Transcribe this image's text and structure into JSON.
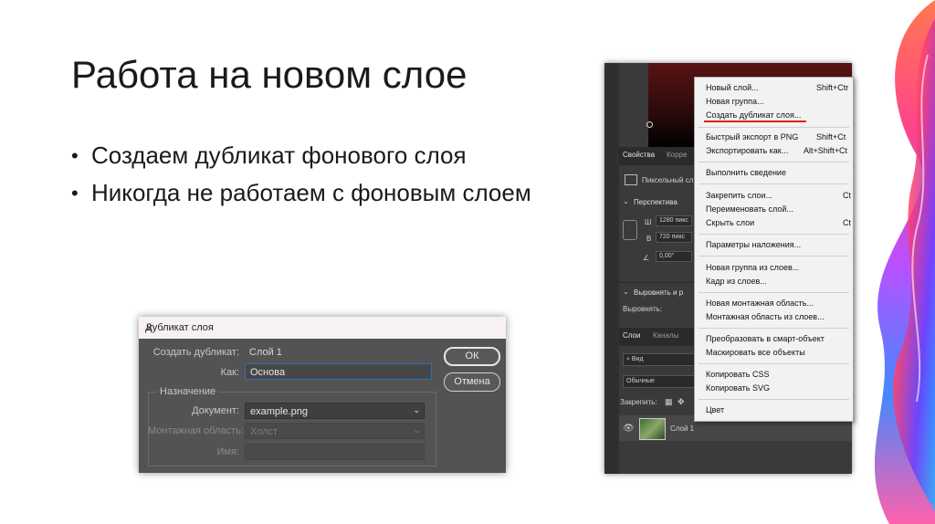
{
  "slide": {
    "title": "Работа на новом слое",
    "bullets": [
      "Создаем дубликат фонового слоя",
      "Никогда не работаем с фоновым слоем"
    ]
  },
  "dialog": {
    "title": "Дубликат слоя",
    "close": "✕",
    "duplicate_label": "Создать дубликат:",
    "duplicate_value": "Слой 1",
    "as_label": "Как:",
    "as_value": "Основа",
    "group_label": "Назначение",
    "document_label": "Документ:",
    "document_value": "example.png",
    "artboard_label": "Монтажная область:",
    "artboard_value": "Холст",
    "name_label": "Имя:",
    "name_value": "",
    "ok": "ОК",
    "cancel": "Отмена"
  },
  "ps_panel": {
    "tab_properties": "Свойства",
    "tab_correction": "Корре",
    "pixel_layer": "Пиксельный сл",
    "perspective": "Перспектива",
    "w_label": "Ш",
    "w_value": "1280 пикс",
    "h_label": "В",
    "h_value": "720 пикс",
    "angle_value": "0,00°",
    "align_section": "Выровнять и р",
    "align_label": "Выровнять:",
    "tab_layers": "Слои",
    "tab_channels": "Каналы",
    "kind_label": "Вид",
    "blend_mode": "Обычные",
    "lock_label": "Закрепить:",
    "layer_name": "Слой 1"
  },
  "menu": {
    "items": [
      {
        "label": "Новый слой...",
        "shortcut": "Shift+Ctr"
      },
      {
        "label": "Новая группа...",
        "shortcut": ""
      },
      {
        "label": "Создать дубликат слоя...",
        "shortcut": ""
      },
      {
        "label": "Быстрый экспорт в PNG",
        "shortcut": "Shift+Ct"
      },
      {
        "label": "Экспортировать как...",
        "shortcut": "Alt+Shift+Ct"
      },
      {
        "label": "Выполнить сведение",
        "shortcut": ""
      },
      {
        "label": "Закрепить слои...",
        "shortcut": "Ct"
      },
      {
        "label": "Переименовать слой...",
        "shortcut": ""
      },
      {
        "label": "Скрыть слои",
        "shortcut": "Ct"
      },
      {
        "label": "Параметры наложения...",
        "shortcut": ""
      },
      {
        "label": "Новая группа из слоев...",
        "shortcut": ""
      },
      {
        "label": "Кадр из слоев...",
        "shortcut": ""
      },
      {
        "label": "Новая монтажная область...",
        "shortcut": ""
      },
      {
        "label": "Монтажная область из слоев...",
        "shortcut": ""
      },
      {
        "label": "Преобразовать в смарт-объект",
        "shortcut": ""
      },
      {
        "label": "Маскировать все объекты",
        "shortcut": ""
      },
      {
        "label": "Копировать CSS",
        "shortcut": ""
      },
      {
        "label": "Копировать SVG",
        "shortcut": ""
      },
      {
        "label": "Цвет",
        "shortcut": ""
      }
    ],
    "highlight_color": "#e11e1e"
  }
}
